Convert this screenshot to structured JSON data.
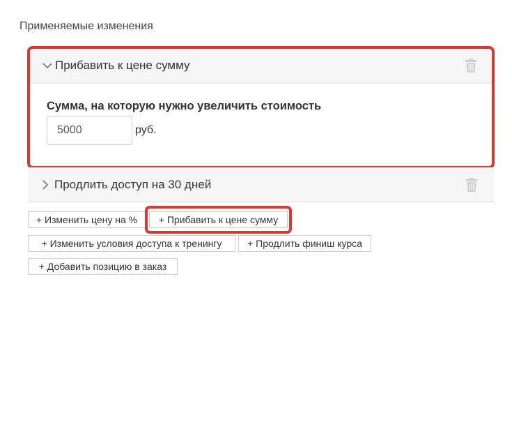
{
  "section_title": "Применяемые изменения",
  "accent_color": "#d9372f",
  "panels": [
    {
      "title": "Прибавить к цене сумму",
      "expanded": true,
      "field_label": "Сумма, на которую нужно увеличить стоимость",
      "amount_value": "5000",
      "unit": "руб."
    },
    {
      "title": "Продлить доступ на 30 дней",
      "expanded": false
    }
  ],
  "add_buttons": [
    "+ Изменить цену на %",
    "+ Прибавить к цене сумму",
    "+ Изменить условия доступа к тренингу",
    "+ Продлить финиш курса",
    "+ Добавить позицию в заказ"
  ]
}
